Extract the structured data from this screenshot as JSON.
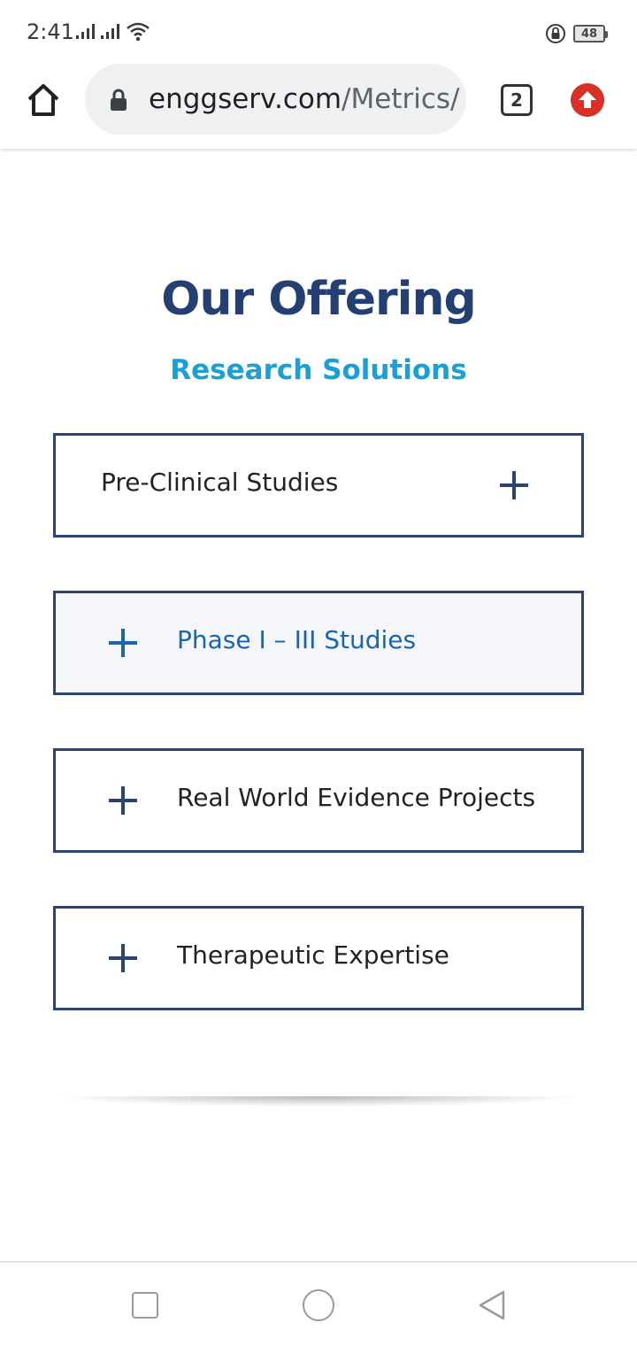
{
  "status_bar": {
    "time": "2:41",
    "battery": "48"
  },
  "browser": {
    "url_host": "enggserv.com",
    "url_path": "/Metrics/",
    "tab_count": "2"
  },
  "content": {
    "title": "Our Offering",
    "subtitle": "Research Solutions",
    "accordion": [
      {
        "label": "Pre-Clinical Studies",
        "expanded": false
      },
      {
        "label": "Phase I – III Studies",
        "expanded": false
      },
      {
        "label": "Real World Evidence Projects",
        "expanded": false
      },
      {
        "label": "Therapeutic Expertise",
        "expanded": false
      }
    ]
  },
  "colors": {
    "title": "#243f72",
    "subtitle": "#1aa0d6",
    "accordion_border": "#2c4570",
    "active_label": "#1c64b0",
    "update_badge": "#d93025"
  }
}
